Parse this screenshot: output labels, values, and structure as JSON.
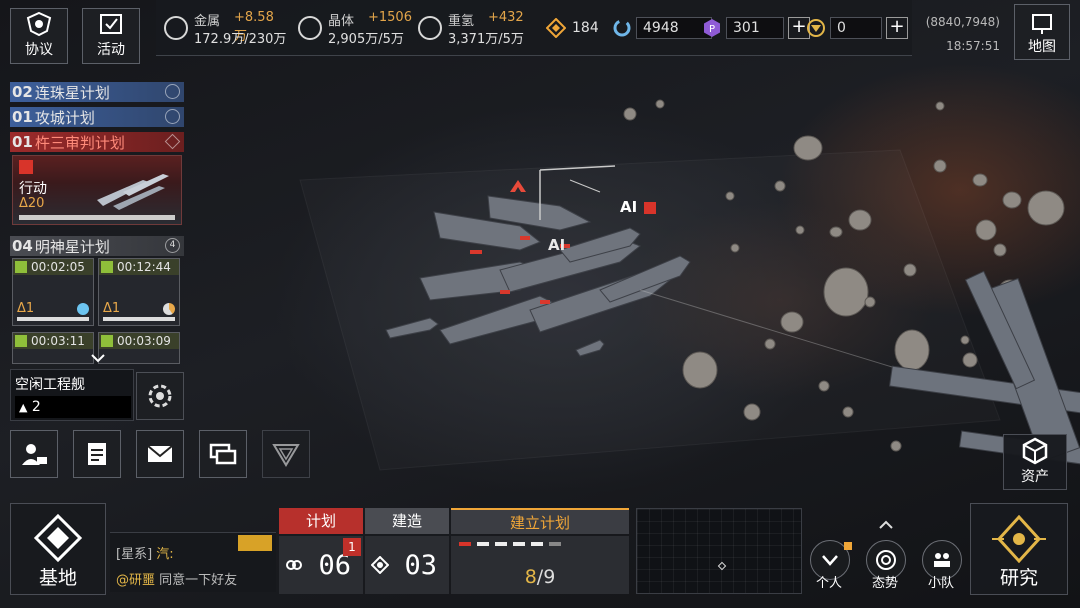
{
  "top_left": {
    "protocol_label": "协议",
    "activity_label": "活动"
  },
  "resources": {
    "metal": {
      "name": "金属",
      "income": "+8.58万",
      "amount": "172.9万/230万"
    },
    "crystal": {
      "name": "晶体",
      "income": "+1506",
      "amount": "2,905万/5万"
    },
    "deuterium": {
      "name": "重氢",
      "income": "+432",
      "amount": "3,371万/5万"
    },
    "fuel": "184",
    "cycle": "4948",
    "premium": "301",
    "token": "0"
  },
  "coords": "(8840,7948)",
  "clock": "18:57:51",
  "map_label": "地图",
  "plans": {
    "p02": {
      "num": "02",
      "name": "连珠星计划"
    },
    "p01": {
      "num": "01",
      "name": "攻城计划"
    },
    "p01r": {
      "num": "01",
      "name": "杵三审判计划"
    },
    "p04": {
      "num": "04",
      "name": "明神星计划",
      "badge": "4"
    },
    "action": {
      "label": "行动",
      "value": "Δ20"
    },
    "timers": [
      {
        "time": "00:02:05",
        "tag": "Δ1"
      },
      {
        "time": "00:12:44",
        "tag": "Δ1"
      },
      {
        "time": "00:03:11"
      },
      {
        "time": "00:03:09"
      }
    ]
  },
  "idle": {
    "label": "空闲工程舰",
    "count": "2"
  },
  "scene": {
    "ai_top": "AI",
    "ai_mid": "AI"
  },
  "bottom": {
    "base_label": "基地",
    "chat": {
      "channel": "[星系]",
      "sender1": "汽:",
      "sender2": "@研噩",
      "message2": "同意一下好友"
    },
    "tabs": {
      "plan": "计划",
      "build": "建造",
      "create": "建立计划"
    },
    "plan_count": "06",
    "plan_badge": "1",
    "build_count": "03",
    "create_current": "8",
    "create_total": "/9",
    "personal_label": "个人",
    "situation_label": "态势",
    "squad_label": "小队",
    "research_label": "研究",
    "assets_label": "资产"
  },
  "colors": {
    "accent_orange": "#e3a54a",
    "plan_blue": "#3d5f9b",
    "plan_red": "#9c2b2b",
    "alert_red": "#c0302a",
    "research_gold": "#e3b648"
  }
}
